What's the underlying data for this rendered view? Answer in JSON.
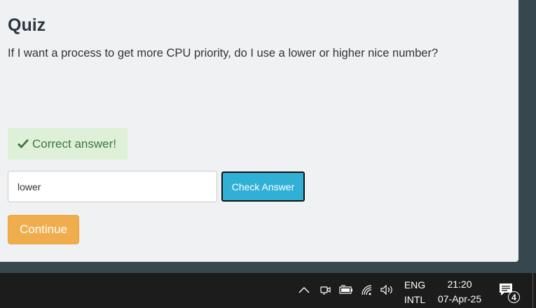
{
  "quiz": {
    "title": "Quiz",
    "question": "If I want a process to get more CPU priority, do I use a lower or higher nice number?",
    "feedback": "Correct answer!",
    "answer_value": "lower",
    "check_label": "Check Answer",
    "continue_label": "Continue"
  },
  "colors": {
    "feedback_bg": "#dff0d8",
    "feedback_text": "#3c763d",
    "check_button": "#31b0d5",
    "continue_button": "#f0ad4e",
    "taskbar": "#1c1c1c"
  },
  "taskbar": {
    "icons": [
      "chevron-up-icon",
      "meet-now-icon",
      "battery-icon",
      "wifi-icon",
      "volume-icon",
      "notification-icon"
    ],
    "lang_line1": "ENG",
    "lang_line2": "INTL",
    "time": "21:20",
    "date": "07-Apr-25",
    "notification_count": "4"
  }
}
